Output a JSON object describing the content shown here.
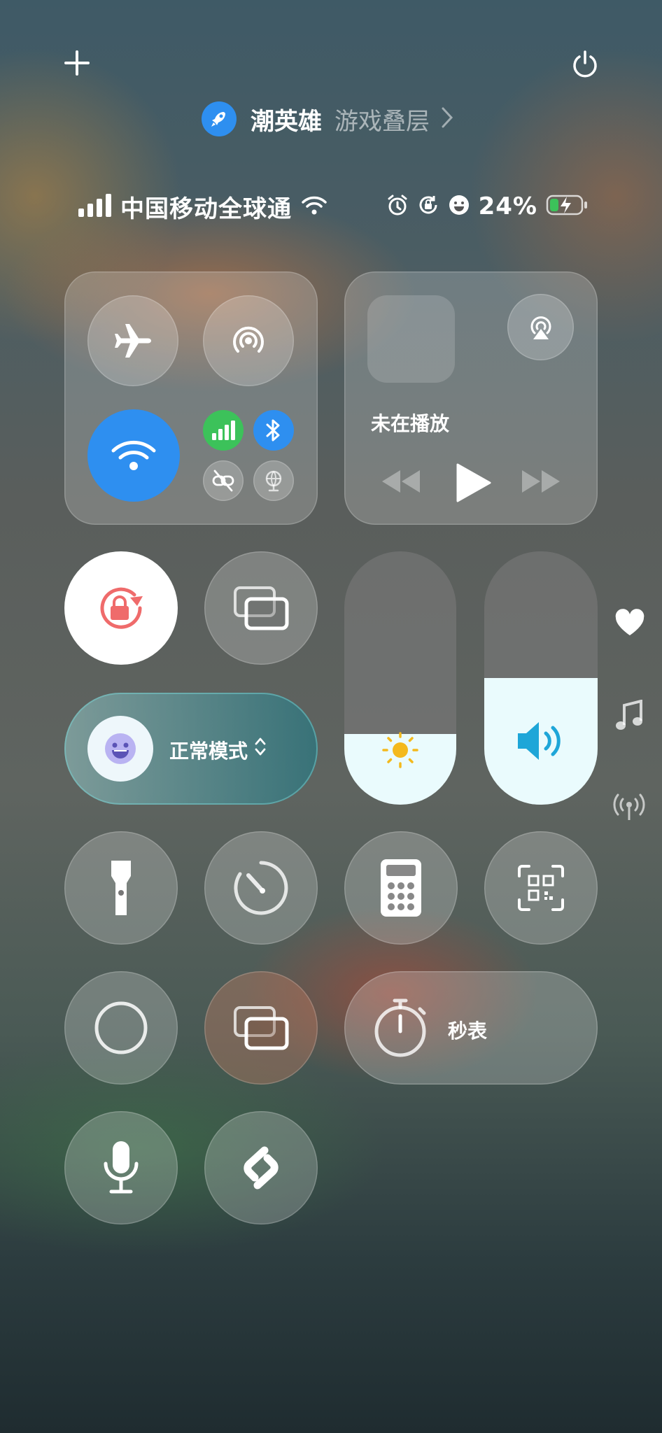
{
  "top_bar": {
    "game_app_name": "潮英雄",
    "overlay_label": "游戏叠层"
  },
  "status_bar": {
    "carrier": "中国移动全球通",
    "battery_percent": "24%",
    "battery_level": 0.24
  },
  "media": {
    "status": "未在播放"
  },
  "mode_pill": {
    "label": "正常模式"
  },
  "stopwatch": {
    "label": "秒表"
  },
  "sliders": {
    "brightness_level": 0.28,
    "volume_level": 0.5
  },
  "colors": {
    "accent_blue": "#2e8ff0",
    "cellular_green": "#3cc25a",
    "rotation_lock_red": "#ef6b6b",
    "volume_blue": "#1ea6d8",
    "sun_yellow": "#f4b91c"
  }
}
